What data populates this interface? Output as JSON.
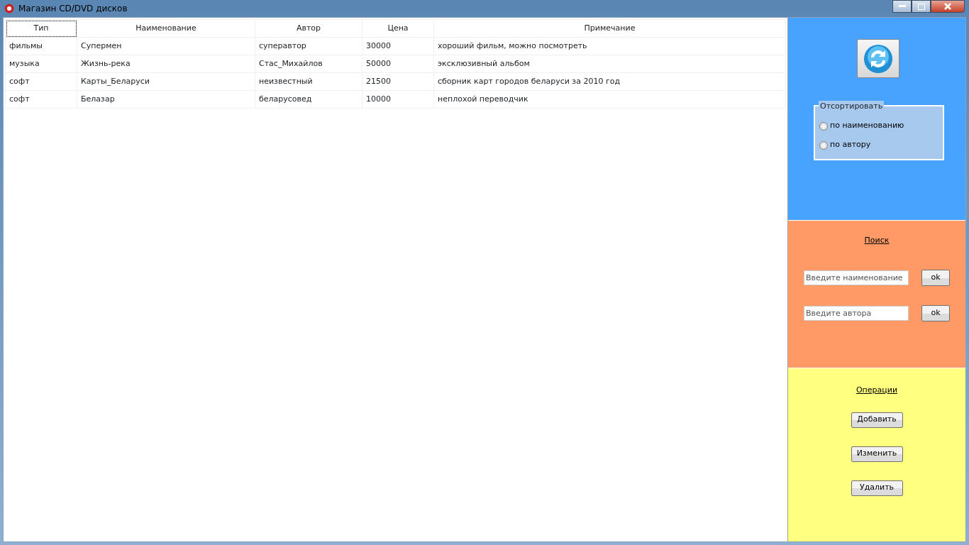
{
  "window": {
    "title": "Магазин CD/DVD дисков"
  },
  "table": {
    "columns": [
      {
        "label": "Тип",
        "focused": true
      },
      {
        "label": "Наименование",
        "focused": false
      },
      {
        "label": "Автор",
        "focused": false
      },
      {
        "label": "Цена",
        "focused": false
      },
      {
        "label": "Примечание",
        "focused": false
      }
    ],
    "rows": [
      [
        "фильмы",
        "Супермен",
        "суперавтор",
        "30000",
        "хороший фильм, можно посмотреть"
      ],
      [
        "музыка",
        "Жизнь-река",
        "Стас_Михайлов",
        "50000",
        "эксклюзивный альбом"
      ],
      [
        "софт",
        "Карты_Беларуси",
        "неизвестный",
        "21500",
        "сборник карт городов беларуси за 2010 год"
      ],
      [
        "софт",
        "Белазар",
        "беларусовед",
        "10000",
        "неплохой переводчик"
      ]
    ]
  },
  "sort": {
    "title": "Отсортировать",
    "options": [
      {
        "label": "по наименованию",
        "selected": false
      },
      {
        "label": "по автору",
        "selected": false
      }
    ]
  },
  "search": {
    "title": "Поиск",
    "fields": [
      {
        "placeholder": "Введите наименование",
        "button": "ok"
      },
      {
        "placeholder": "Введите автора",
        "button": "ok"
      }
    ]
  },
  "operations": {
    "title": "Операции",
    "buttons": [
      "Добавить",
      "Изменить",
      "Удалить"
    ]
  }
}
